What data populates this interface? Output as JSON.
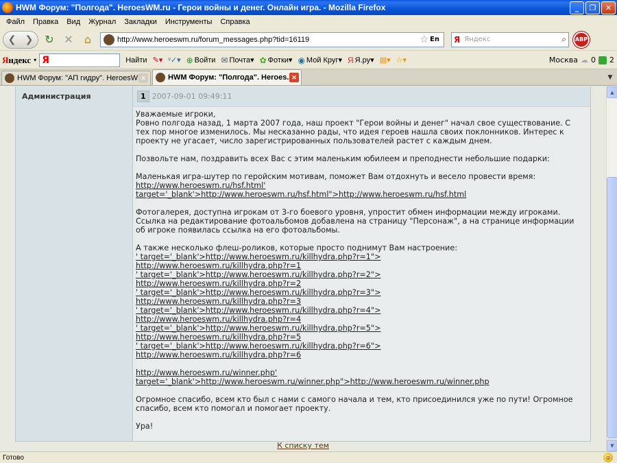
{
  "window": {
    "title": "HWM Форум: \"Полгода\". HeroesWM.ru - Герои войны и денег. Онлайн игра. - Mozilla Firefox",
    "minimize": "_",
    "maximize": "❐",
    "close": "✕"
  },
  "menu": [
    "Файл",
    "Правка",
    "Вид",
    "Журнал",
    "Закладки",
    "Инструменты",
    "Справка"
  ],
  "nav": {
    "url": "http://www.heroeswm.ru/forum_messages.php?tid=16119",
    "lang": "En",
    "search_brand": "Я",
    "search_placeholder": "Яндекс",
    "abp": "ABP"
  },
  "yandex_bar": {
    "brand_ya": "Я",
    "brand_rest": "ндекс",
    "input_glyph": "Я",
    "find": "Найти",
    "login": "Войти",
    "mail": "Почта",
    "photos": "Фотки",
    "my_circle": "Мой Круг",
    "yaru": "Я.ру",
    "city": "Москва",
    "weather_val": "0",
    "count": "2"
  },
  "tabs": [
    {
      "label": "HWM Форум: \"АП гидру\". HeroesWM.r...",
      "active": false
    },
    {
      "label": "HWM Форум: \"Полгода\". Heroes...",
      "active": true
    }
  ],
  "post": {
    "author_role": "Администрация",
    "number": "1",
    "date": "2007-09-01 09:49:11",
    "greeting": "Уважаемые игроки,",
    "p1": "Ровно полгода назад, 1 марта 2007 года, наш проект \"Герои войны и денег\" начал свое существование. С тех пор многое изменилось. Мы несказанно рады, что идея героев нашла своих поклонников. Интерес к проекту не угасает, число зарегистрированных пользователей растет с каждым днем.",
    "p2": "Позвольте нам, поздравить всех Вас с этим маленьким юбилеем и преподнести небольшие подарки:",
    "p3": "Маленькая игра-шутер по геройским мотивам, поможет Вам отдохнуть и весело провести время:",
    "hsf_link": "http://www.heroeswm.ru/hsf.html' target='_blank'>http://www.heroeswm.ru/hsf.html\">http://www.heroeswm.ru/hsf.html",
    "p4": "Фотогалерея, доступна игрокам от 3-го боевого уровня, упростит обмен информации между игроками. Ссылка на редактирование фотоальбомов добавлена на страницу \"Персонаж\", а на странице информации об игроке появилась ссылка на его фотоальбомы.",
    "p5": "А также несколько флеш-роликов, которые просто поднимут Вам настроение:",
    "hydra_links": [
      "' target='_blank'>http://www.heroeswm.ru/killhydra.php?r=1\">",
      "http://www.heroeswm.ru/killhydra.php?r=1",
      "' target='_blank'>http://www.heroeswm.ru/killhydra.php?r=2\">",
      "http://www.heroeswm.ru/killhydra.php?r=2",
      "' target='_blank'>http://www.heroeswm.ru/killhydra.php?r=3\">",
      "http://www.heroeswm.ru/killhydra.php?r=3",
      "' target='_blank'>http://www.heroeswm.ru/killhydra.php?r=4\">",
      "http://www.heroeswm.ru/killhydra.php?r=4",
      "' target='_blank'>http://www.heroeswm.ru/killhydra.php?r=5\">",
      "http://www.heroeswm.ru/killhydra.php?r=5",
      "' target='_blank'>http://www.heroeswm.ru/killhydra.php?r=6\">",
      "http://www.heroeswm.ru/killhydra.php?r=6"
    ],
    "winner_link": "http://www.heroeswm.ru/winner.php' target='_blank'>http://www.heroeswm.ru/winner.php\">http://www.heroeswm.ru/winner.php",
    "p6": "Огромное спасибо, всем кто был с нами с самого начала и тем, кто присоединился уже по пути! Огромное спасибо, всем кто помогал и помогает проекту.",
    "p7": "Ура!"
  },
  "back_link": "К списку тем",
  "status": "Готово"
}
